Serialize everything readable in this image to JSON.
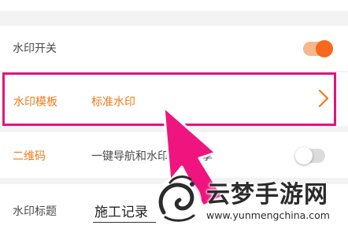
{
  "rows": {
    "watermark_switch": {
      "label": "水印开关",
      "enabled": true
    },
    "watermark_template": {
      "label": "水印模板",
      "value": "标准水印"
    },
    "qr_code": {
      "label": "二维码",
      "description": "一键导航和水印信息分享",
      "enabled": false
    },
    "watermark_title": {
      "label": "水印标题",
      "value": "施工记录"
    }
  },
  "overlay": {
    "logo_text": "云梦手游网",
    "logo_url": "www.yunmengchina.com"
  },
  "colors": {
    "accent": "#f07a18",
    "toggle_on": "#f7681c",
    "highlight": "#e2147d"
  },
  "icons": [
    "chevron-right-icon",
    "pointer-arrow-icon",
    "dragon-logo-icon"
  ]
}
